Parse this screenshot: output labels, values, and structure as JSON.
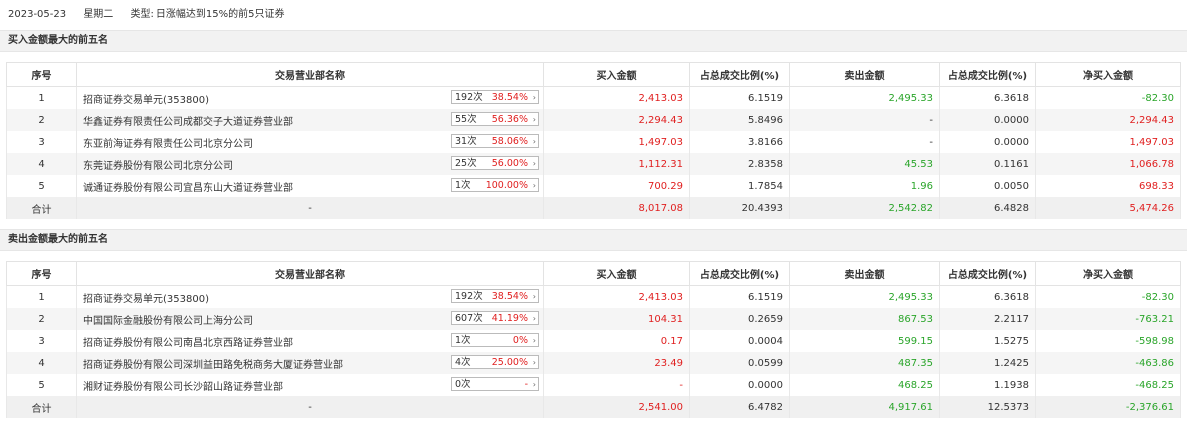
{
  "header": {
    "date": "2023-05-23",
    "weekday": "星期二",
    "type_label": "类型:",
    "type_value": "日涨幅达到15%的前5只证券"
  },
  "columns": [
    "序号",
    "交易营业部名称",
    "买入金额",
    "占总成交比例(%)",
    "卖出金额",
    "占总成交比例(%)",
    "净买入金额"
  ],
  "buy_section": {
    "title": "买入金额最大的前五名",
    "rows": [
      {
        "no": "1",
        "name": "招商证券交易单元(353800)",
        "times": "192次",
        "pct": "38.54%",
        "buy": "2,413.03",
        "buy_ratio": "6.1519",
        "sell": "2,495.33",
        "sell_ratio": "6.3618",
        "net": "-82.30",
        "net_color": "green",
        "sell_color": "green"
      },
      {
        "no": "2",
        "name": "华鑫证券有限责任公司成都交子大道证券营业部",
        "times": "55次",
        "pct": "56.36%",
        "buy": "2,294.43",
        "buy_ratio": "5.8496",
        "sell": "-",
        "sell_ratio": "0.0000",
        "net": "2,294.43",
        "net_color": "red",
        "sell_color": "none"
      },
      {
        "no": "3",
        "name": "东亚前海证券有限责任公司北京分公司",
        "times": "31次",
        "pct": "58.06%",
        "buy": "1,497.03",
        "buy_ratio": "3.8166",
        "sell": "-",
        "sell_ratio": "0.0000",
        "net": "1,497.03",
        "net_color": "red",
        "sell_color": "none"
      },
      {
        "no": "4",
        "name": "东莞证券股份有限公司北京分公司",
        "times": "25次",
        "pct": "56.00%",
        "buy": "1,112.31",
        "buy_ratio": "2.8358",
        "sell": "45.53",
        "sell_ratio": "0.1161",
        "net": "1,066.78",
        "net_color": "red",
        "sell_color": "green"
      },
      {
        "no": "5",
        "name": "诚通证券股份有限公司宜昌东山大道证券营业部",
        "times": "1次",
        "pct": "100.00%",
        "buy": "700.29",
        "buy_ratio": "1.7854",
        "sell": "1.96",
        "sell_ratio": "0.0050",
        "net": "698.33",
        "net_color": "red",
        "sell_color": "green"
      }
    ],
    "total": {
      "label": "合计",
      "name": "-",
      "buy": "8,017.08",
      "buy_ratio": "20.4393",
      "sell": "2,542.82",
      "sell_ratio": "6.4828",
      "net": "5,474.26",
      "net_color": "red"
    }
  },
  "sell_section": {
    "title": "卖出金额最大的前五名",
    "rows": [
      {
        "no": "1",
        "name": "招商证券交易单元(353800)",
        "times": "192次",
        "pct": "38.54%",
        "buy": "2,413.03",
        "buy_ratio": "6.1519",
        "sell": "2,495.33",
        "sell_ratio": "6.3618",
        "net": "-82.30",
        "net_color": "green",
        "sell_color": "green",
        "buy_color": "red"
      },
      {
        "no": "2",
        "name": "中国国际金融股份有限公司上海分公司",
        "times": "607次",
        "pct": "41.19%",
        "buy": "104.31",
        "buy_ratio": "0.2659",
        "sell": "867.53",
        "sell_ratio": "2.2117",
        "net": "-763.21",
        "net_color": "green",
        "sell_color": "green",
        "buy_color": "red"
      },
      {
        "no": "3",
        "name": "招商证券股份有限公司南昌北京西路证券营业部",
        "times": "1次",
        "pct": "0%",
        "buy": "0.17",
        "buy_ratio": "0.0004",
        "sell": "599.15",
        "sell_ratio": "1.5275",
        "net": "-598.98",
        "net_color": "green",
        "sell_color": "green",
        "buy_color": "red"
      },
      {
        "no": "4",
        "name": "招商证券股份有限公司深圳益田路免税商务大厦证券营业部",
        "times": "4次",
        "pct": "25.00%",
        "buy": "23.49",
        "buy_ratio": "0.0599",
        "sell": "487.35",
        "sell_ratio": "1.2425",
        "net": "-463.86",
        "net_color": "green",
        "sell_color": "green",
        "buy_color": "red"
      },
      {
        "no": "5",
        "name": "湘财证券股份有限公司长沙韶山路证券营业部",
        "times": "0次",
        "pct": "-",
        "buy": "-",
        "buy_ratio": "0.0000",
        "sell": "468.25",
        "sell_ratio": "1.1938",
        "net": "-468.25",
        "net_color": "green",
        "sell_color": "green",
        "buy_color": "red"
      }
    ],
    "total": {
      "label": "合计",
      "name": "-",
      "buy": "2,541.00",
      "buy_ratio": "6.4782",
      "sell": "4,917.61",
      "sell_ratio": "12.5373",
      "net": "-2,376.61",
      "net_color": "green"
    }
  },
  "colors": {
    "up": "#e01f1f",
    "down": "#2aa52a",
    "header_bg": "#f2f2f2"
  }
}
